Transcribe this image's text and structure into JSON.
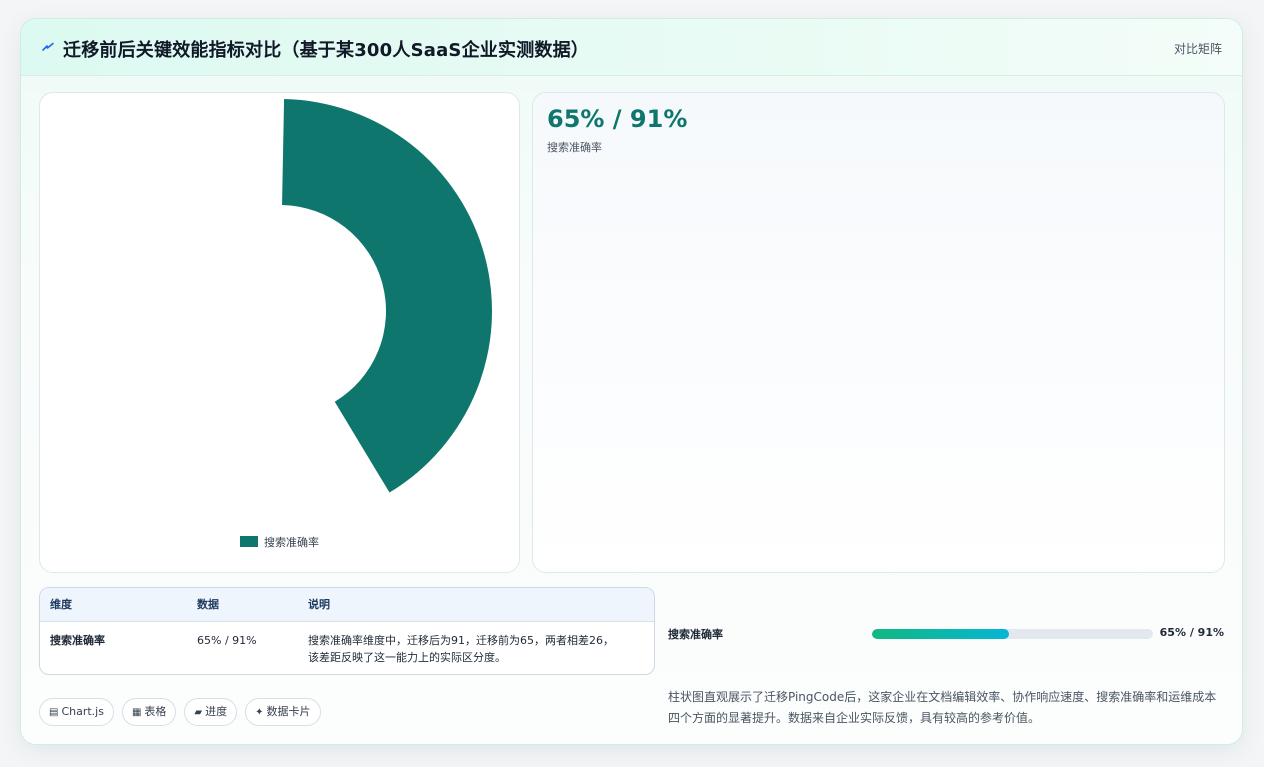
{
  "header": {
    "title": "迁移前后关键效能指标对比（基于某300人SaaS企业实测数据）",
    "mode_link": "对比矩阵",
    "icon": "lightning-icon"
  },
  "chart_data": {
    "type": "pie",
    "variant": "doughnut",
    "categories": [
      "搜索准确率"
    ],
    "series": [
      {
        "name": "搜索准确率",
        "values": [
          65,
          91
        ]
      }
    ],
    "colors": [
      "#0f766e",
      "#ffffff"
    ],
    "legend": {
      "position": "bottom",
      "entries": [
        "搜索准确率"
      ]
    }
  },
  "metric_card": {
    "value": "65% / 91%",
    "label": "搜索准确率"
  },
  "table": {
    "headers": [
      "维度",
      "数据",
      "说明"
    ],
    "rows": [
      {
        "dimension": "搜索准确率",
        "data": "65% / 91%",
        "note_line1": "搜索准确率维度中，迁移后为91，迁移前为65，两者相差26，",
        "note_line2": "该差距反映了这一能力上的实际区分度。"
      }
    ]
  },
  "progress": {
    "label": "搜索准确率",
    "value_text": "65% / 91%",
    "fraction": 0.4893,
    "colors": [
      "#10b981",
      "#06b6d4"
    ]
  },
  "description": "柱状图直观展示了迁移PingCode后，这家企业在文档编辑效率、协作响应速度、搜索准确率和运维成本四个方面的显著提升。数据来自企业实际反馈，具有较高的参考价值。",
  "view_chips": [
    {
      "icon": "chart-icon",
      "glyph": "▤",
      "label": "Chart.js"
    },
    {
      "icon": "table-icon",
      "glyph": "▦",
      "label": "表格"
    },
    {
      "icon": "progress-icon",
      "glyph": "▰",
      "label": "进度"
    },
    {
      "icon": "sparkle-icon",
      "glyph": "✦",
      "label": "数据卡片"
    }
  ]
}
